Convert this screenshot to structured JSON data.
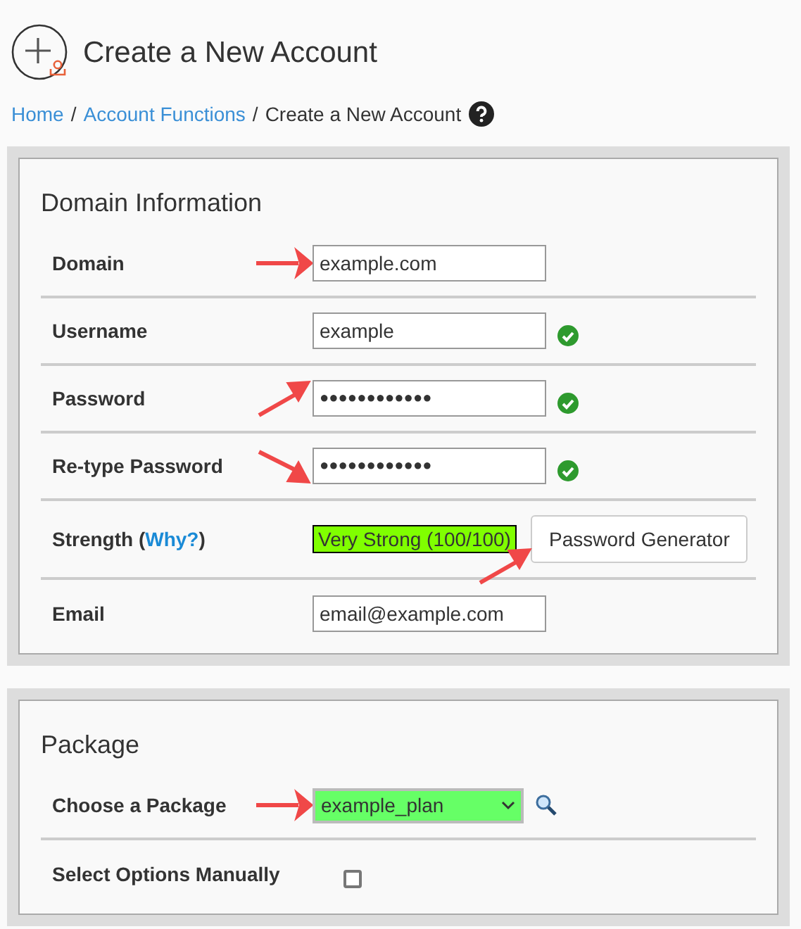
{
  "page_title": "Create a New Account",
  "breadcrumb": [
    {
      "label": "Home",
      "kind": "link",
      "separator": "/"
    },
    {
      "label": "Account Functions",
      "kind": "link",
      "separator": "/"
    },
    {
      "label": "Create a New Account",
      "kind": "current"
    }
  ],
  "sections": [
    {
      "heading": "Domain Information",
      "rows": [
        {
          "kind": "text",
          "label": "Domain",
          "value": "example.com",
          "valid": false,
          "annotation": {
            "kind": "right"
          }
        },
        {
          "kind": "text",
          "label": "Username",
          "value": "example",
          "valid": true
        },
        {
          "kind": "password",
          "label": "Password",
          "value": "●●●●●●●●●●●●",
          "valid": true,
          "annotation": {
            "kind": "up-right"
          }
        },
        {
          "kind": "password",
          "label": "Re-type Password",
          "value": "●●●●●●●●●●●●",
          "valid": true,
          "annotation": {
            "kind": "down-right"
          }
        },
        {
          "kind": "strength",
          "label": "Strength (",
          "link": "Why?",
          "label_end": ")",
          "value": "Very Strong (100/100)",
          "button": "Password Generator",
          "annotation": {
            "kind": "up-right"
          }
        },
        {
          "kind": "text",
          "label": "Email",
          "value": "email@example.com",
          "valid": false
        }
      ]
    },
    {
      "heading": "Package",
      "rows": [
        {
          "kind": "select",
          "label": "Choose a Package",
          "value": "example_plan",
          "annotation": {
            "kind": "right"
          }
        },
        {
          "kind": "checkbox",
          "label": "Select Options Manually",
          "checked": false
        }
      ]
    }
  ]
}
